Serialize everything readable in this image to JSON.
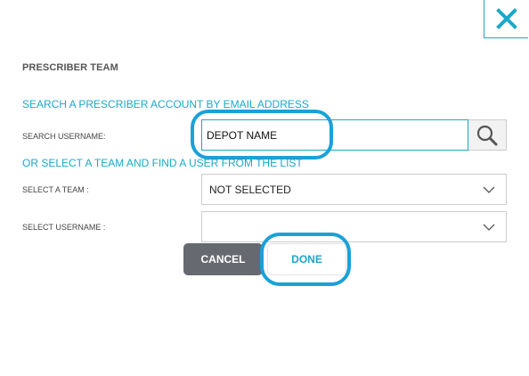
{
  "dialog": {
    "title": "PRESCRIBER TEAM",
    "close_icon": "close-icon"
  },
  "search": {
    "section_label": "SEARCH A PRESCRIBER ACCOUNT BY EMAIL ADDRESS",
    "field_label": "SEARCH USERNAME:",
    "value": "DEPOT NAME",
    "button_icon": "search-icon"
  },
  "team": {
    "section_label": "OR SELECT A TEAM AND FIND A USER FROM THE LIST",
    "team_label": "SELECT A TEAM :",
    "team_value": "NOT SELECTED",
    "username_label": "SELECT USERNAME :",
    "username_value": ""
  },
  "actions": {
    "cancel_label": "CANCEL",
    "done_label": "DONE"
  },
  "colors": {
    "accent": "#1ba8c9",
    "highlight": "#1aa1d8",
    "cancel_bg": "#666a70"
  }
}
